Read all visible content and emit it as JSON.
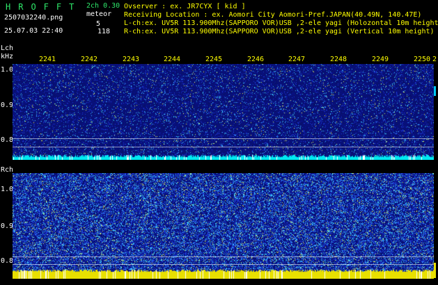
{
  "app": {
    "title": "HROFFT",
    "filename": "2507032240.png",
    "datetime": "25.07.03 22:40",
    "mode": "2ch 0.30",
    "meteor_label": "meteor",
    "meteor_count_l": "5",
    "meteor_count_r": "118"
  },
  "info": {
    "observer": "Ovserver            : ex. JR7CYX [ kid ]",
    "location": "Receiving Location : ex. Aomori City Aomori-Pref.JAPAN(40.49N, 140.47E)",
    "lch": "L-ch:ex. UV5R 113.900Mhz(SAPPORO VOR)USB ,2-ele yagi (Holozontal 10m height)",
    "rch": "R-ch:ex. UV5R 113.900Mhz(SAPPORO VOR)USB ,2-ele yagi (Vertical 10m height)"
  },
  "lch_panel": {
    "label": "Lch",
    "unit": "kHz",
    "y_ticks": [
      "1.0",
      "0.9",
      "0.8"
    ]
  },
  "rch_panel": {
    "label": "Rch",
    "y_ticks": [
      "1.0",
      "0.9",
      "0.8"
    ]
  },
  "time_axis": {
    "ticks": [
      "2241",
      "2242",
      "2243",
      "2244",
      "2245",
      "2246",
      "2247",
      "2248",
      "2249",
      "2250",
      "2"
    ]
  },
  "colors": {
    "background": "#000000",
    "title_green": "#2ee86a",
    "info_yellow": "#ffff00",
    "spectrum_dark": "#08106a",
    "spectrum_bright": "#2030c8",
    "noise_cyan": "#40d8ff",
    "noise_yellow": "#ffff40",
    "baseline_cyan": "#00e8f0"
  }
}
